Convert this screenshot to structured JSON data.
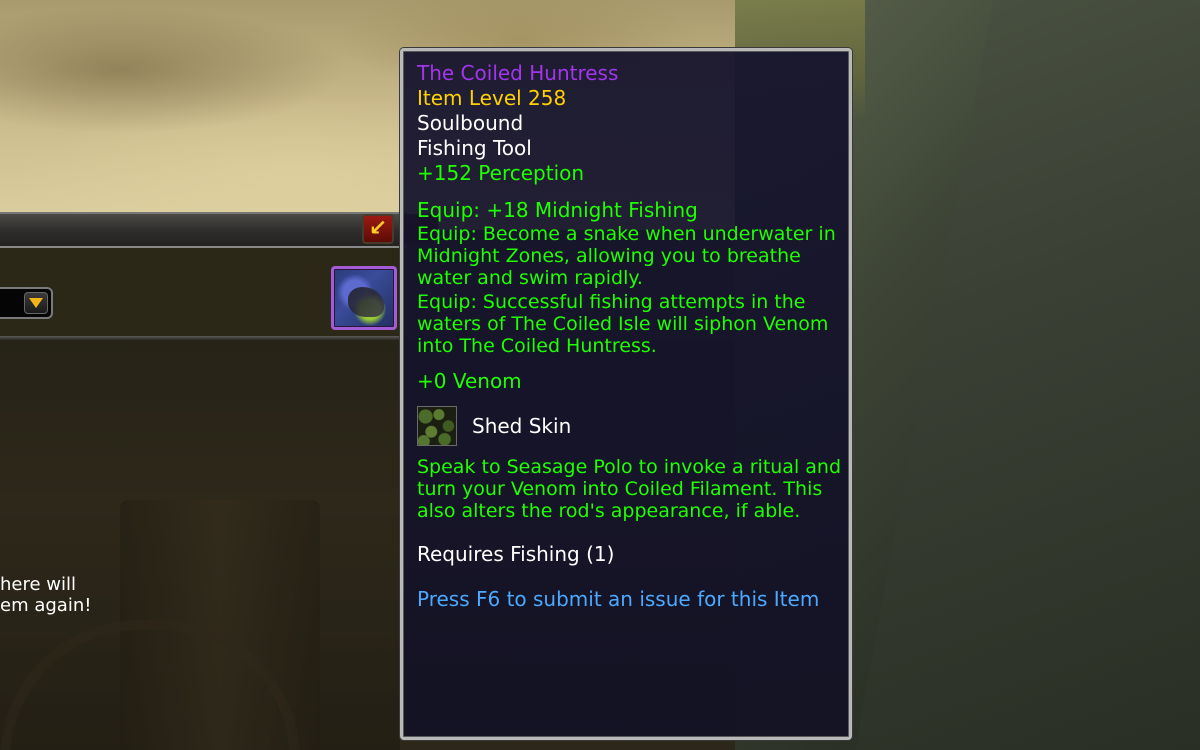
{
  "tooltip": {
    "item_name": "The Coiled Huntress",
    "item_level": "Item Level 258",
    "binding": "Soulbound",
    "item_type": "Fishing Tool",
    "stat_perception": "+152 Perception",
    "equip_1": "Equip: +18 Midnight Fishing",
    "equip_2": "Equip: Become a snake when underwater in Midnight Zones, allowing you to breathe water and swim rapidly.",
    "equip_3": "Equip: Successful fishing attempts in the waters of The Coiled Isle will siphon Venom into The Coiled Huntress.",
    "venom": "+0 Venom",
    "spell_name": "Shed Skin",
    "spell_description": "Speak to Seasage Polo to invoke a ritual and turn your Venom into Coiled Filament. This also alters the rod's appearance, if able.",
    "requirement": "Requires Fishing (1)",
    "feedback_hint": "Press F6 to submit an issue for this Item"
  },
  "panel": {
    "text_line_1": "here will",
    "text_line_2": "em again!"
  },
  "colors": {
    "epic_purple": "#a335ee",
    "item_level_gold": "#ffd100",
    "white": "#ffffff",
    "green": "#1eff00",
    "hint_blue": "#4ba9ff"
  },
  "icons": {
    "collapse_button": "arrow-down-left-icon",
    "dropdown": "chevron-down-icon",
    "item_slot": "fishing-rod-item-icon",
    "spell": "snake-scales-icon"
  }
}
